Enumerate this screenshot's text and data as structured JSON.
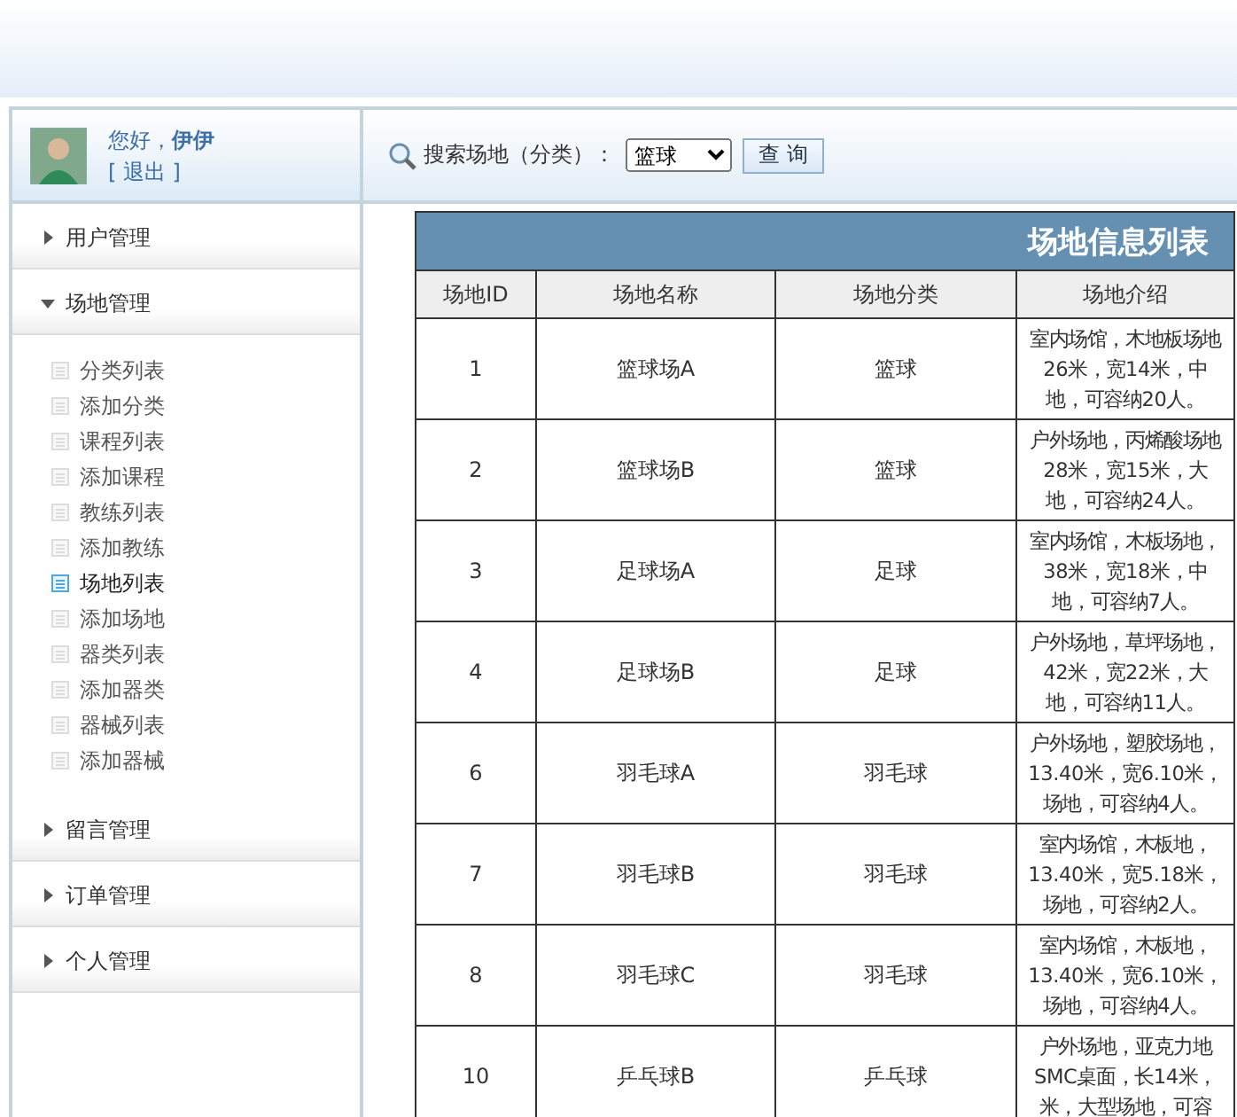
{
  "user": {
    "greeting": "您好，**伊伊**",
    "logout": "[ 退出 ]"
  },
  "sidebar": {
    "groups": [
      {
        "label": "用户管理",
        "expanded": false
      },
      {
        "label": "场地管理",
        "expanded": true,
        "items": [
          {
            "label": "分类列表",
            "selected": false
          },
          {
            "label": "添加分类",
            "selected": false
          },
          {
            "label": "课程列表",
            "selected": false
          },
          {
            "label": "添加课程",
            "selected": false
          },
          {
            "label": "教练列表",
            "selected": false
          },
          {
            "label": "添加教练",
            "selected": false
          },
          {
            "label": "场地列表",
            "selected": true
          },
          {
            "label": "添加场地",
            "selected": false
          },
          {
            "label": "器类列表",
            "selected": false
          },
          {
            "label": "添加器类",
            "selected": false
          },
          {
            "label": "器械列表",
            "selected": false
          },
          {
            "label": "添加器械",
            "selected": false
          }
        ]
      },
      {
        "label": "留言管理",
        "expanded": false
      },
      {
        "label": "订单管理",
        "expanded": false
      },
      {
        "label": "个人管理",
        "expanded": false
      }
    ]
  },
  "search": {
    "label": "搜索场地（分类）：",
    "category": "篮球",
    "button": "查 询"
  },
  "table": {
    "title": "场地信息列表",
    "columns": [
      "场地ID",
      "场地名称",
      "场地分类",
      "场地介绍"
    ],
    "rows": [
      {
        "id": "1",
        "name": "篮球场A",
        "category": "篮球",
        "description": [
          "室内场馆，木地板场地",
          "26米，宽14米，中",
          "地，可容纳20人。"
        ]
      },
      {
        "id": "2",
        "name": "篮球场B",
        "category": "篮球",
        "description": [
          "户外场地，丙烯酸场地",
          "28米，宽15米，大",
          "地，可容纳24人。"
        ]
      },
      {
        "id": "3",
        "name": "足球场A",
        "category": "足球",
        "description": [
          "室内场馆，木板场地，",
          "38米，宽18米，中",
          "地，可容纳7人。"
        ]
      },
      {
        "id": "4",
        "name": "足球场B",
        "category": "足球",
        "description": [
          "户外场地，草坪场地，",
          "42米，宽22米，大",
          "地，可容纳11人。"
        ]
      },
      {
        "id": "6",
        "name": "羽毛球A",
        "category": "羽毛球",
        "description": [
          "户外场地，塑胶场地，",
          "13.40米，宽6.10米，",
          "场地，可容纳4人。"
        ]
      },
      {
        "id": "7",
        "name": "羽毛球B",
        "category": "羽毛球",
        "description": [
          "室内场馆，木板地，",
          "13.40米，宽5.18米，",
          "场地，可容纳2人。"
        ]
      },
      {
        "id": "8",
        "name": "羽毛球C",
        "category": "羽毛球",
        "description": [
          "室内场馆，木板地，",
          "13.40米，宽6.10米，",
          "场地，可容纳4人。"
        ]
      },
      {
        "id": "10",
        "name": "乒乓球B",
        "category": "乒乓球",
        "description": [
          "户外场地，亚克力地",
          "SMC桌面，长14米，",
          "米，大型场地，可容"
        ]
      }
    ]
  }
}
